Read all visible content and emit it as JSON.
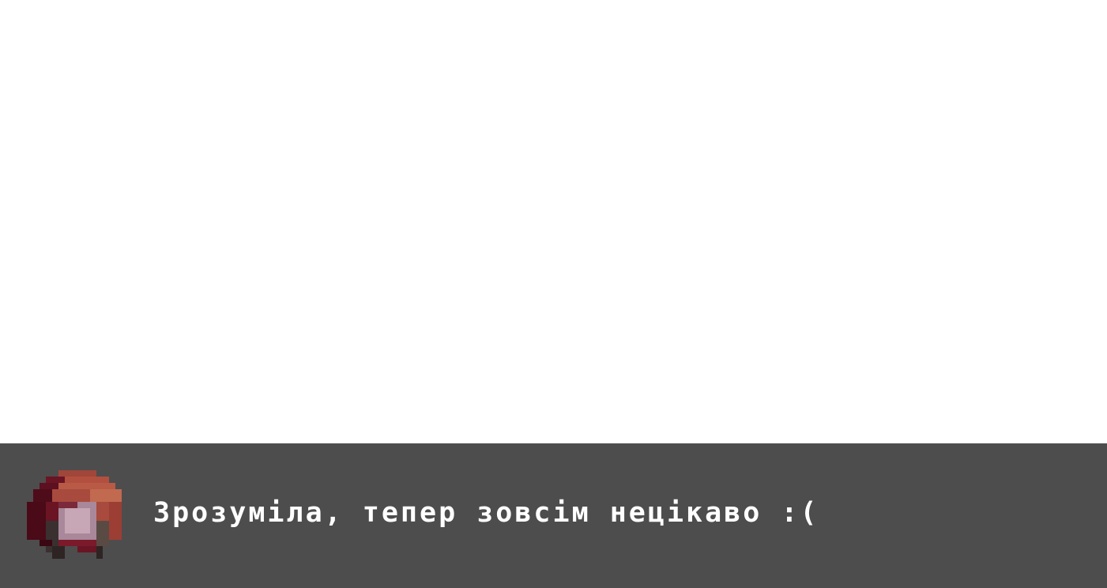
{
  "dialog": {
    "speaker_portrait": "red-hooded-girl-portrait",
    "text": "Зрозуміла, тепер зовсім нецікаво :("
  },
  "colors": {
    "scene_background": "#ffffff",
    "dialog_background": "#4d4d4d",
    "text": "#ffffff"
  }
}
